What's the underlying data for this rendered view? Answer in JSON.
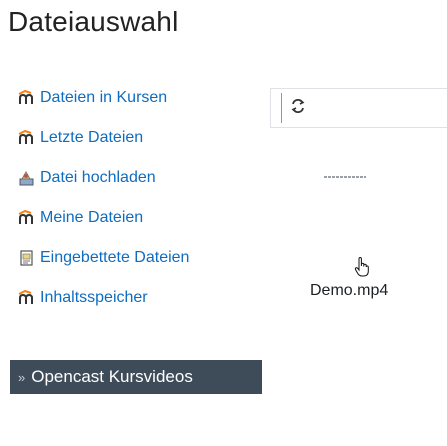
{
  "dialog": {
    "title": "Dateiauswahl"
  },
  "repositories": [
    {
      "label": "Dateien in Kursen",
      "icon": "moodle-icon"
    },
    {
      "label": "Letzte Dateien",
      "icon": "moodle-icon"
    },
    {
      "label": "Datei hochladen",
      "icon": "upload-icon"
    },
    {
      "label": "Meine Dateien",
      "icon": "moodle-icon"
    },
    {
      "label": "Eingebettete Dateien",
      "icon": "embedded-files-icon"
    },
    {
      "label": "Inhaltsspeicher",
      "icon": "moodle-icon"
    },
    {
      "label": "Opencast Kursvideos",
      "icon": "chevron-right-icon",
      "active": true
    }
  ],
  "content": {
    "files": [
      {
        "name": "Demo.mp4"
      }
    ],
    "refresh_icon": "refresh-icon"
  },
  "colors": {
    "link": "#0f6cbf",
    "active_bg": "#3e4b58",
    "moodle_orange": "#f98012"
  }
}
